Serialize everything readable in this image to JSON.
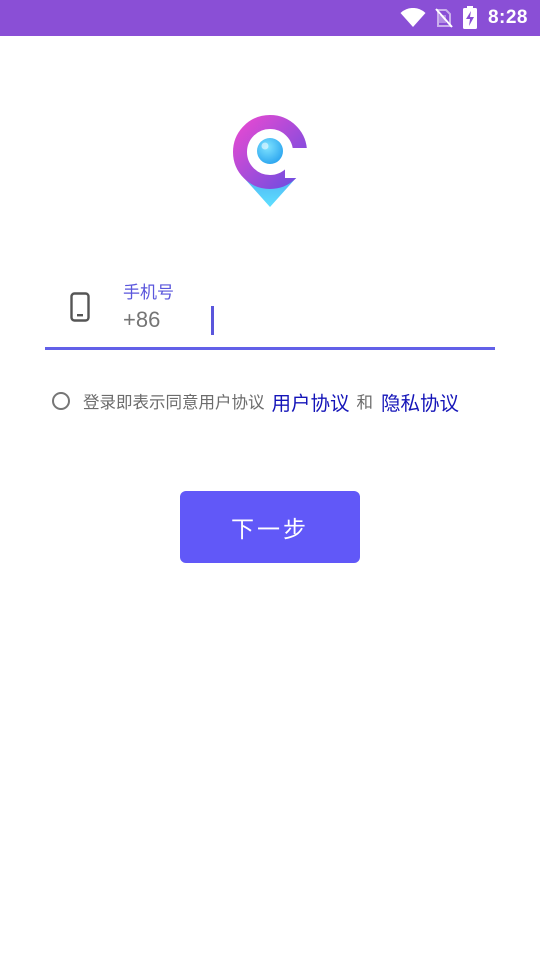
{
  "status_bar": {
    "time": "8:28",
    "icons": [
      "wifi-icon",
      "no-sim-icon",
      "battery-charging-icon"
    ],
    "background": "#8a4fd6"
  },
  "logo": {
    "icon": "location-search-pin-logo"
  },
  "phone_field": {
    "label": "手机号",
    "value": "",
    "placeholder": "+86",
    "icon": "smartphone-icon",
    "accent": "#6260e8"
  },
  "agreement": {
    "text": "登录即表示同意用户协议",
    "user_agreement_link": "用户协议",
    "and": "和",
    "privacy_link": "隐私协议",
    "link_color": "#1414b8"
  },
  "next_button": {
    "label": "下一步",
    "background": "#6158f8"
  }
}
